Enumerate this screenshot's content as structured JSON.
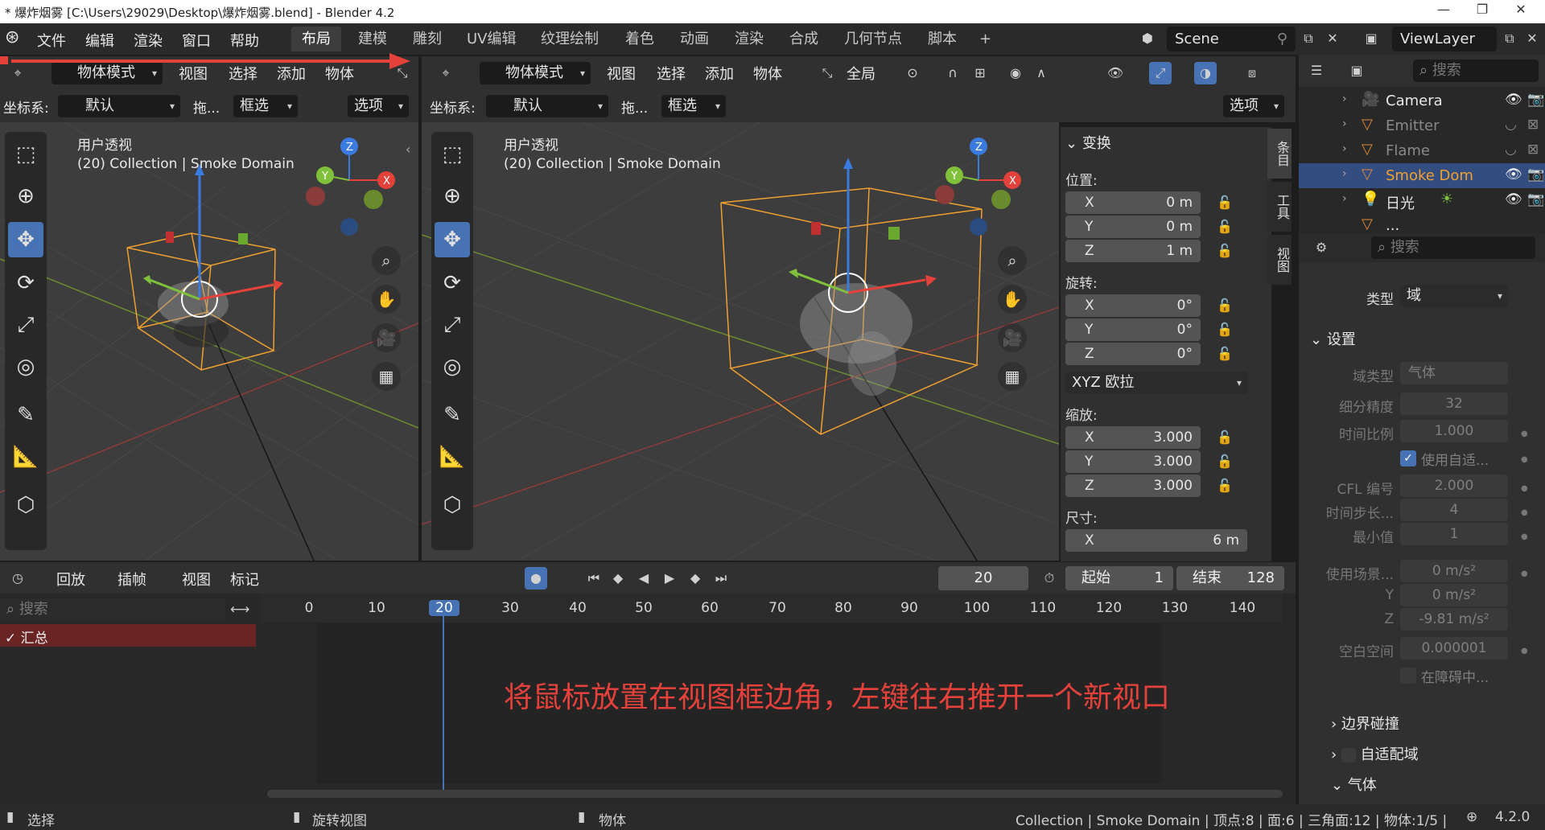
{
  "window": {
    "title": "* 爆炸烟雾 [C:\\Users\\29029\\Desktop\\爆炸烟雾.blend] - Blender 4.2",
    "minimize": "—",
    "maximize": "❐",
    "close": "✕"
  },
  "menu": {
    "items": [
      "文件",
      "编辑",
      "渲染",
      "窗口",
      "帮助"
    ],
    "workspaces": [
      "布局",
      "建模",
      "雕刻",
      "UV编辑",
      "纹理绘制",
      "着色",
      "动画",
      "渲染",
      "合成",
      "几何节点",
      "脚本"
    ],
    "add_tab": "+",
    "scene": "Scene",
    "view_layer": "ViewLayer"
  },
  "left_viewport": {
    "mode": "物体模式",
    "menus": [
      "视图",
      "选择",
      "添加",
      "物体"
    ],
    "coord_label": "坐标系:",
    "coord_value": "默认",
    "drag_label": "拖...",
    "select_mode": "框选",
    "options": "选项",
    "view_name": "用户透视",
    "view_sub": "(20) Collection | Smoke Domain"
  },
  "right_viewport": {
    "mode": "物体模式",
    "menus": [
      "视图",
      "选择",
      "添加",
      "物体"
    ],
    "global": "全局",
    "coord_label": "坐标系:",
    "coord_value": "默认",
    "drag_label": "拖...",
    "select_mode": "框选",
    "options": "选项",
    "view_name": "用户透视",
    "view_sub": "(20) Collection | Smoke Domain"
  },
  "npanel": {
    "section": "变换",
    "location_label": "位置:",
    "location": [
      {
        "axis": "X",
        "value": "0 m"
      },
      {
        "axis": "Y",
        "value": "0 m"
      },
      {
        "axis": "Z",
        "value": "1 m"
      }
    ],
    "rotation_label": "旋转:",
    "rotation": [
      {
        "axis": "X",
        "value": "0°"
      },
      {
        "axis": "Y",
        "value": "0°"
      },
      {
        "axis": "Z",
        "value": "0°"
      }
    ],
    "rotation_mode": "XYZ 欧拉",
    "scale_label": "缩放:",
    "scale": [
      {
        "axis": "X",
        "value": "3.000"
      },
      {
        "axis": "Y",
        "value": "3.000"
      },
      {
        "axis": "Z",
        "value": "3.000"
      }
    ],
    "dimensions_label": "尺寸:",
    "dimensions_x": {
      "axis": "X",
      "value": "6 m"
    },
    "tabs": [
      "条目",
      "工具",
      "视图"
    ]
  },
  "outliner": {
    "search_placeholder": "搜索",
    "rows": [
      {
        "name": "Camera",
        "icon": "camera-object-icon",
        "selected": false
      },
      {
        "name": "Emitter",
        "icon": "mesh-object-icon",
        "selected": false
      },
      {
        "name": "Flame",
        "icon": "mesh-object-icon",
        "selected": false
      },
      {
        "name": "Smoke Dom",
        "icon": "mesh-object-icon",
        "selected": true
      },
      {
        "name": "日光",
        "icon": "light-object-icon",
        "selected": false
      },
      {
        "name": "...",
        "icon": "mesh-object-icon",
        "selected": false
      }
    ]
  },
  "properties": {
    "search_placeholder": "搜索",
    "type_label": "类型",
    "type_value": "域",
    "settings_section": "设置",
    "domain_type_label": "域类型",
    "domain_type_value": "气体",
    "resolution_label": "细分精度",
    "resolution_value": "32",
    "time_scale_label": "时间比例",
    "time_scale_value": "1.000",
    "adaptive_label": "使用自适...",
    "cfl_label": "CFL 编号",
    "cfl_value": "2.000",
    "timesteps_max_label": "时间步长...",
    "timesteps_max_value": "4",
    "min_label": "最小值",
    "min_value": "1",
    "gravity_label": "使用场景...",
    "gravity_x": "0 m/s²",
    "gravity_y_label": "Y",
    "gravity_y": "0 m/s²",
    "gravity_z_label": "Z",
    "gravity_z": "-9.81 m/s²",
    "empty_label": "空白空间",
    "empty_value": "0.000001",
    "obstacle_label": "在障碍中...",
    "border_section": "边界碰撞",
    "adaptive_domain_section": "自适配域",
    "gas_section": "气体"
  },
  "timeline": {
    "playback": "回放",
    "keying": "插帧",
    "view": "视图",
    "marker": "标记",
    "current_frame": "20",
    "start_label": "起始",
    "start_value": "1",
    "end_label": "结束",
    "end_value": "128",
    "ruler": [
      "0",
      "10",
      "20",
      "30",
      "40",
      "50",
      "60",
      "70",
      "80",
      "90",
      "100",
      "110",
      "120",
      "130",
      "140"
    ],
    "summary": "汇总",
    "search_placeholder": "搜索",
    "annotation": "将鼠标放置在视图框边角，左键往右推开一个新视口"
  },
  "statusbar": {
    "select": "选择",
    "rotate_view": "旋转视图",
    "object": "物体",
    "stats": "Collection | Smoke Domain | 顶点:8 | 面:6 | 三角面:12 | 物体:1/5 |",
    "version": "4.2.0"
  },
  "colors": {
    "accent": "#4772b3",
    "annotation": "#e5413b",
    "selection_outline": "#f0a030",
    "axis_x": "#e5413b",
    "axis_y": "#7fc13b",
    "axis_z": "#3a7be0"
  }
}
